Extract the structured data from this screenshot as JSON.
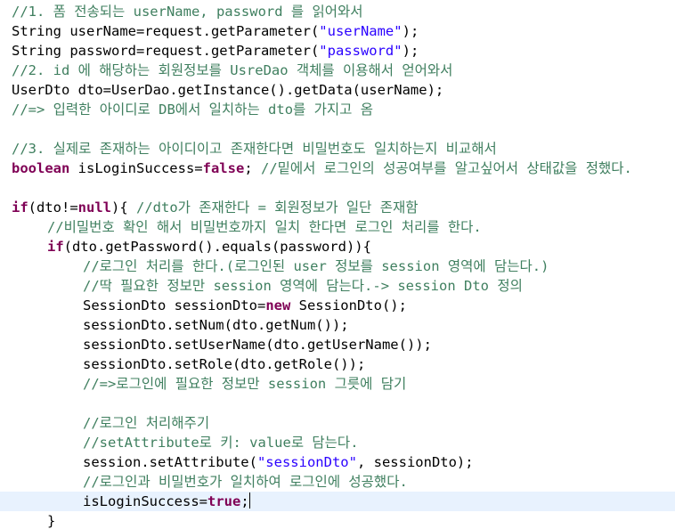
{
  "colors": {
    "background": "#ffffff",
    "code": "#000000",
    "comment": "#3f7f5f",
    "keyword": "#7f0055",
    "string": "#2a00ff",
    "current_line": "#e8f2fe"
  },
  "editor": {
    "current_line_index": 25,
    "caret_after_line_index": 25,
    "lines": [
      {
        "indent": 0,
        "tokens": [
          {
            "t": "comment",
            "v": "//1. 폼 전송되는 userName, password 를 읽어와서"
          }
        ]
      },
      {
        "indent": 0,
        "tokens": [
          {
            "t": "code",
            "v": "String userName=request.getParameter("
          },
          {
            "t": "str",
            "v": "\"userName\""
          },
          {
            "t": "code",
            "v": ");"
          }
        ]
      },
      {
        "indent": 0,
        "tokens": [
          {
            "t": "code",
            "v": "String password=request.getParameter("
          },
          {
            "t": "str",
            "v": "\"password\""
          },
          {
            "t": "code",
            "v": ");"
          }
        ]
      },
      {
        "indent": 0,
        "tokens": [
          {
            "t": "comment",
            "v": "//2. id 에 해당하는 회원정보를 UsreDao 객체를 이용해서 얻어와서"
          }
        ]
      },
      {
        "indent": 0,
        "tokens": [
          {
            "t": "code",
            "v": "UserDto dto=UserDao.getInstance().getData(userName);"
          }
        ]
      },
      {
        "indent": 0,
        "tokens": [
          {
            "t": "comment",
            "v": "//=> 입력한 아이디로 DB에서 일치하는 dto를 가지고 옴"
          }
        ]
      },
      {
        "indent": 0,
        "tokens": []
      },
      {
        "indent": 0,
        "tokens": [
          {
            "t": "comment",
            "v": "//3. 실제로 존재하는 아이디이고 존재한다면 비밀번호도 일치하는지 비교해서"
          }
        ]
      },
      {
        "indent": 0,
        "tokens": [
          {
            "t": "kw",
            "v": "boolean"
          },
          {
            "t": "code",
            "v": " isLoginSuccess="
          },
          {
            "t": "kw",
            "v": "false"
          },
          {
            "t": "code",
            "v": "; "
          },
          {
            "t": "comment",
            "v": "//밑에서 로그인의 성공여부를 알고싶어서 상태값을 정했다."
          }
        ]
      },
      {
        "indent": 0,
        "tokens": []
      },
      {
        "indent": 0,
        "tokens": [
          {
            "t": "kw",
            "v": "if"
          },
          {
            "t": "code",
            "v": "(dto!="
          },
          {
            "t": "kw",
            "v": "null"
          },
          {
            "t": "code",
            "v": "){ "
          },
          {
            "t": "comment",
            "v": "//dto가 존재한다 = 회원정보가 일단 존재함"
          }
        ]
      },
      {
        "indent": 1,
        "tokens": [
          {
            "t": "comment",
            "v": "//비밀번호 확인 해서 비밀번호까지 일치 한다면 로그인 처리를 한다."
          }
        ]
      },
      {
        "indent": 1,
        "tokens": [
          {
            "t": "kw",
            "v": "if"
          },
          {
            "t": "code",
            "v": "(dto.getPassword().equals(password)){"
          }
        ]
      },
      {
        "indent": 2,
        "tokens": [
          {
            "t": "comment",
            "v": "//로그인 처리를 한다.(로그인된 user 정보를 session 영역에 담는다.)"
          }
        ]
      },
      {
        "indent": 2,
        "tokens": [
          {
            "t": "comment",
            "v": "//딱 필요한 정보만 session 영역에 담는다.-> session Dto 정의"
          }
        ]
      },
      {
        "indent": 2,
        "tokens": [
          {
            "t": "code",
            "v": "SessionDto sessionDto="
          },
          {
            "t": "kw",
            "v": "new"
          },
          {
            "t": "code",
            "v": " SessionDto();"
          }
        ]
      },
      {
        "indent": 2,
        "tokens": [
          {
            "t": "code",
            "v": "sessionDto.setNum(dto.getNum());"
          }
        ]
      },
      {
        "indent": 2,
        "tokens": [
          {
            "t": "code",
            "v": "sessionDto.setUserName(dto.getUserName());"
          }
        ]
      },
      {
        "indent": 2,
        "tokens": [
          {
            "t": "code",
            "v": "sessionDto.setRole(dto.getRole());"
          }
        ]
      },
      {
        "indent": 2,
        "tokens": [
          {
            "t": "comment",
            "v": "//=>로그인에 필요한 정보만 session 그릇에 담기"
          }
        ]
      },
      {
        "indent": 0,
        "tokens": []
      },
      {
        "indent": 2,
        "tokens": [
          {
            "t": "comment",
            "v": "//로그인 처리해주기"
          }
        ]
      },
      {
        "indent": 2,
        "tokens": [
          {
            "t": "comment",
            "v": "//setAttribute로 키: value로 담는다."
          }
        ]
      },
      {
        "indent": 2,
        "tokens": [
          {
            "t": "code",
            "v": "session.setAttribute("
          },
          {
            "t": "str",
            "v": "\"sessionDto\""
          },
          {
            "t": "code",
            "v": ", sessionDto);"
          }
        ]
      },
      {
        "indent": 2,
        "tokens": [
          {
            "t": "comment",
            "v": "//로그인과 비밀번호가 일치하여 로그인에 성공했다."
          }
        ]
      },
      {
        "indent": 2,
        "tokens": [
          {
            "t": "code",
            "v": "isLoginSuccess="
          },
          {
            "t": "kw",
            "v": "true"
          },
          {
            "t": "code",
            "v": ";"
          }
        ]
      },
      {
        "indent": 1,
        "tokens": [
          {
            "t": "code",
            "v": "}"
          }
        ]
      }
    ]
  }
}
